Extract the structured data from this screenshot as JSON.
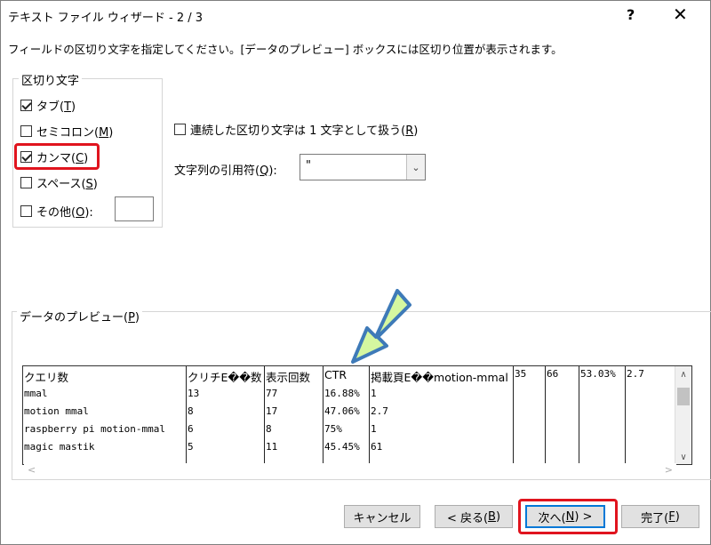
{
  "window": {
    "title": "テキスト ファイル ウィザード - 2 / 3",
    "help": "?",
    "close": "✕"
  },
  "instruction": "フィールドの区切り文字を指定してください。[データのプレビュー] ボックスには区切り位置が表示されます。",
  "delimiters": {
    "group_label": "区切り文字",
    "tab": {
      "label": "タブ(",
      "key": "T",
      "end": ")",
      "checked": true
    },
    "semicolon": {
      "label": "セミコロン(",
      "key": "M",
      "end": ")",
      "checked": false
    },
    "comma": {
      "label": "カンマ(",
      "key": "C",
      "end": ")",
      "checked": true
    },
    "space": {
      "label": "スペース(",
      "key": "S",
      "end": ")",
      "checked": false
    },
    "other": {
      "label": "その他(",
      "key": "O",
      "end": "):",
      "checked": false,
      "value": ""
    }
  },
  "consecutive": {
    "label": "連続した区切り文字は 1 文字として扱う(",
    "key": "R",
    "end": ")",
    "checked": false
  },
  "text_qualifier": {
    "label": "文字列の引用符(",
    "key": "Q",
    "end": "):",
    "value": "\""
  },
  "preview": {
    "label": "データのプレビュー(",
    "key": "P",
    "end": ")",
    "rows": [
      [
        "クエリ数",
        "クリチE��数",
        "表示回数",
        "CTR",
        "掲載頁E��motion-mmal",
        "35",
        "66",
        "53.03%",
        "2.7"
      ],
      [
        "mmal",
        "13",
        "77",
        "16.88%",
        "1",
        "",
        "",
        "",
        ""
      ],
      [
        "motion mmal",
        "8",
        "17",
        "47.06%",
        "2.7",
        "",
        "",
        "",
        ""
      ],
      [
        "raspberry pi motion-mmal",
        "6",
        "8",
        "75%",
        "1",
        "",
        "",
        "",
        ""
      ],
      [
        "magic mastik",
        "5",
        "11",
        "45.45%",
        "61",
        "",
        "",
        "",
        ""
      ]
    ]
  },
  "buttons": {
    "cancel": "キャンセル",
    "back": {
      "label": "< 戻る(",
      "key": "B",
      "end": ")"
    },
    "next": {
      "label": "次へ(",
      "key": "N",
      "end": ") >"
    },
    "finish": {
      "label": "完了(",
      "key": "F",
      "end": ")"
    }
  },
  "colors": {
    "highlight": "#e0141e",
    "arrow_fill": "#d5f7a0",
    "arrow_stroke": "#3e7ab8",
    "focus": "#0078d7"
  }
}
